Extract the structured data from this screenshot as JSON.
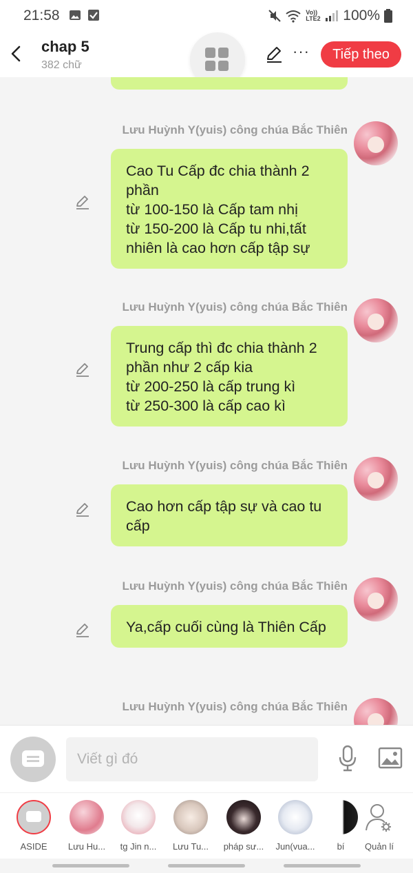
{
  "status_bar": {
    "time": "21:58",
    "network": "Vo)) LTE2",
    "battery": "100%"
  },
  "header": {
    "title": "chap 5",
    "word_count": "382 chữ",
    "next_button": "Tiếp theo",
    "more_glyph": "···"
  },
  "messages": [
    {
      "sender": "Lưu Huỳnh Y(yuis) công chúa Bắc Thiên",
      "text": "Cao Tu Cấp đc chia thành 2 phần\ntừ 100-150 là Cấp tam nhị\ntừ 150-200 là Cấp tu nhi,tất nhiên là cao hơn cấp tập sự"
    },
    {
      "sender": "Lưu Huỳnh Y(yuis) công chúa Bắc Thiên",
      "text": "Trung cấp thì đc chia thành 2 phần như 2 cấp kia\ntừ 200-250 là cấp trung kì\ntừ 250-300 là cấp cao kì"
    },
    {
      "sender": "Lưu Huỳnh Y(yuis) công chúa Bắc Thiên",
      "text": "Cao hơn cấp tập sự và cao tu cấp"
    },
    {
      "sender": "Lưu Huỳnh Y(yuis) công chúa Bắc Thiên",
      "text": "Ya,cấp cuối cùng là Thiên Cấp"
    },
    {
      "sender": "Lưu Huỳnh Y(yuis) công chúa Bắc Thiên",
      "text": ""
    }
  ],
  "input": {
    "placeholder": "Viết gì đó"
  },
  "characters": [
    {
      "label": "ASIDE"
    },
    {
      "label": "Lưu Hu..."
    },
    {
      "label": "tg Jin n..."
    },
    {
      "label": "Lưu Tu..."
    },
    {
      "label": "pháp sư..."
    },
    {
      "label": "Jun(vua..."
    },
    {
      "label": "bí"
    },
    {
      "label": "Quản lí"
    }
  ],
  "colors": {
    "accent": "#f03c44",
    "bubble": "#d5f58f"
  }
}
